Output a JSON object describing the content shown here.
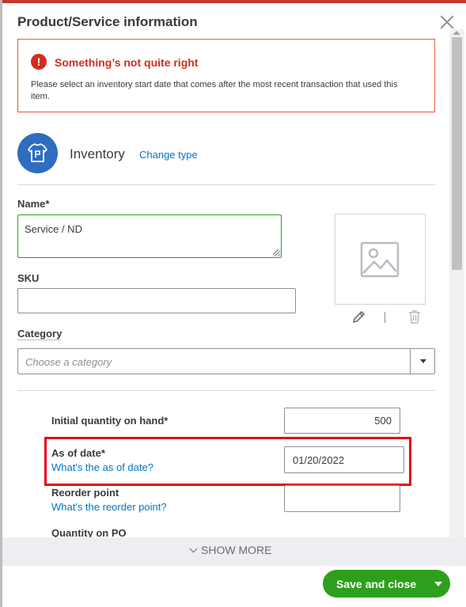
{
  "dialog": {
    "title": "Product/Service information"
  },
  "error": {
    "icon": "exclamation-icon",
    "icon_glyph": "!",
    "title": "Something’s not quite right",
    "message": "Please select an inventory start date that comes after the most recent transaction that used this item."
  },
  "item_type": {
    "icon": "t-shirt-icon",
    "label": "Inventory",
    "change_link": "Change type"
  },
  "form": {
    "name_label": "Name*",
    "name_value": "Service / ND",
    "sku_label": "SKU",
    "sku_value": "",
    "category_label": "Category",
    "category_placeholder": "Choose a category",
    "initial_qty_label": "Initial quantity on hand*",
    "initial_qty_value": "500",
    "as_of_label": "As of date*",
    "as_of_help": "What's the as of date?",
    "as_of_value": "01/20/2022",
    "reorder_label": "Reorder point",
    "reorder_help": "What's the reorder point?",
    "reorder_value": "",
    "qty_po_label": "Quantity on PO"
  },
  "footer": {
    "show_more": "SHOW MORE",
    "save_label": "Save and close"
  },
  "colors": {
    "accent_green": "#2ca01c",
    "error_red": "#d52b1e",
    "link_blue": "#0077c5",
    "highlight_red": "#e8001c",
    "type_circle_blue": "#2e6dbf"
  }
}
